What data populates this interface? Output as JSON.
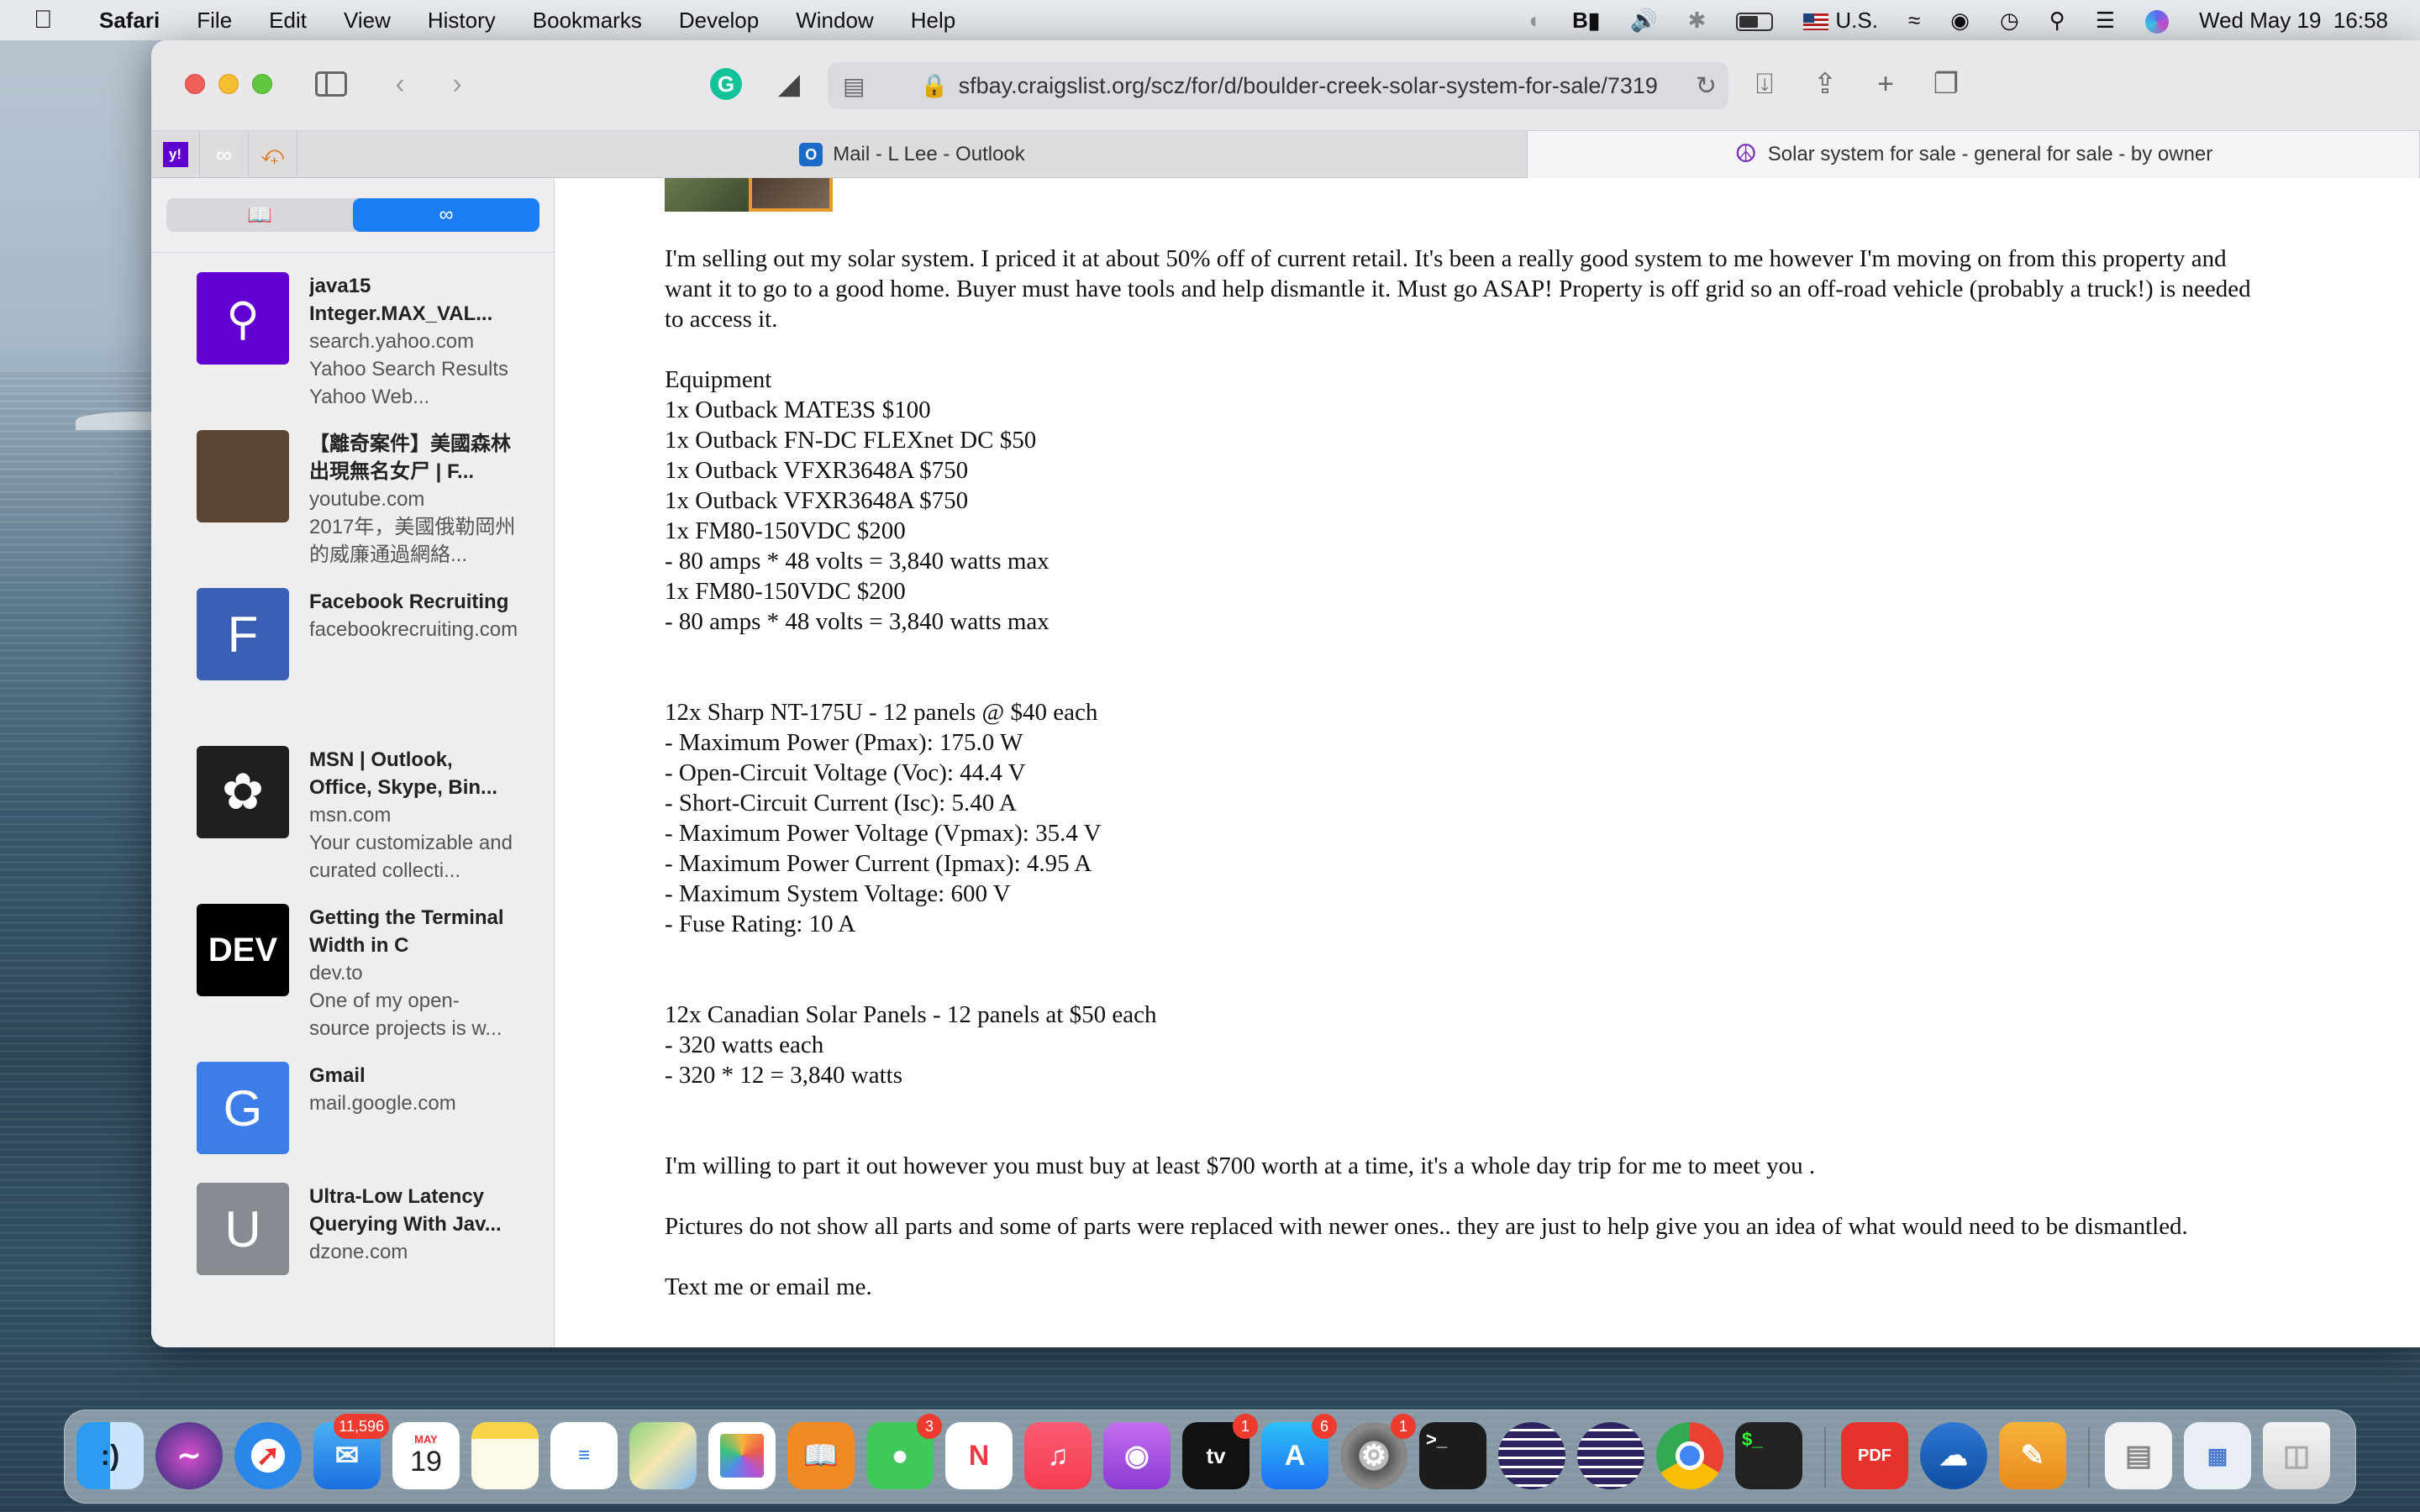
{
  "menubar": {
    "app_name": "Safari",
    "items": [
      "File",
      "Edit",
      "View",
      "History",
      "Bookmarks",
      "Develop",
      "Window",
      "Help"
    ],
    "input_source": "U.S.",
    "datetime": "Wed May 19  16:58"
  },
  "toolbar": {
    "url": "sfbay.craigslist.org/scz/for/d/boulder-creek-solar-system-for-sale/7319"
  },
  "tabs": [
    {
      "label": "Mail - L Lee - Outlook",
      "icon": "outlook-icon"
    },
    {
      "label": "Solar system for sale - general for sale - by owner",
      "icon": "peace-icon"
    }
  ],
  "pinned_tabs": [
    "yahoo-icon",
    "reading-list-icon",
    "custom-site-icon"
  ],
  "sidebar": {
    "reading_list": [
      {
        "title": "java15 Integer.MAX_VAL...",
        "domain": "search.yahoo.com",
        "snippet": "Yahoo Search Results Yahoo Web...",
        "thumb": "yahoo-thumb",
        "color": "#6001d2"
      },
      {
        "title": "【離奇案件】美國森林出現無名女尸 | F...",
        "domain": "youtube.com",
        "snippet": "2017年，美國俄勒岡州的威廉通過網絡...",
        "thumb": "video-thumb",
        "color": "#5a4636"
      },
      {
        "title": "Facebook Recruiting",
        "domain": "facebookrecruiting.com",
        "snippet": "",
        "thumb_letter": "F",
        "color": "#3b5fb5"
      },
      {
        "title": "MSN | Outlook, Office, Skype, Bin...",
        "domain": "msn.com",
        "snippet": "Your customizable and curated collecti...",
        "thumb": "msn-thumb",
        "color": "#1f1f1f"
      },
      {
        "title": "Getting the Terminal Width in C",
        "domain": "dev.to",
        "snippet": "One of my open-source projects is w...",
        "thumb_letter": "DEV",
        "color": "#000000"
      },
      {
        "title": "Gmail",
        "domain": "mail.google.com",
        "snippet": "",
        "thumb_letter": "G",
        "color": "#3d7de8"
      },
      {
        "title": "Ultra-Low Latency Querying With Jav...",
        "domain": "dzone.com",
        "snippet": "",
        "thumb_letter": "U",
        "color": "#878c93"
      }
    ]
  },
  "post": {
    "lines": [
      "I'm selling out my solar system. I priced it at about 50% off of current retail. It's been a really good system to me however I'm moving on from this property and want it to go to a good home. Buyer must have tools and help dismantle it. Must go ASAP! Property is off grid so an off-road vehicle (probably a truck!) is needed to access it.",
      "",
      "Equipment",
      "1x Outback MATE3S $100",
      "1x Outback FN-DC FLEXnet DC $50",
      "1x Outback VFXR3648A $750",
      "1x Outback VFXR3648A $750",
      "1x FM80-150VDC $200",
      "- 80 amps * 48 volts = 3,840 watts max",
      "1x FM80-150VDC $200",
      "- 80 amps * 48 volts = 3,840 watts max",
      "",
      "",
      "12x Sharp NT-175U - 12 panels @ $40 each",
      "- Maximum Power (Pmax): 175.0 W",
      "- Open-Circuit Voltage (Voc): 44.4 V",
      "- Short-Circuit Current (Isc): 5.40 A",
      "- Maximum Power Voltage (Vpmax): 35.4 V",
      "- Maximum Power Current (Ipmax): 4.95 A",
      "- Maximum System Voltage: 600 V",
      "- Fuse Rating: 10 A",
      "",
      "",
      "12x Canadian Solar Panels - 12 panels at $50 each",
      "- 320 watts each",
      "- 320 * 12 = 3,840 watts",
      "",
      "",
      "I'm willing to part it out however you must buy at least $700 worth at a time, it's a whole day trip for me to meet you .",
      "",
      "Pictures do not show all parts and some of parts were replaced with newer ones.. they are just to help give you an idea of what would need to be dismantled.",
      "",
      "Text me or email me."
    ]
  },
  "dock": {
    "mail_badge": "11,596",
    "calendar_month": "MAY",
    "calendar_day": "19",
    "messages_badge": "3",
    "tv_badge": "1",
    "appstore_badge": "6",
    "settings_badge": "1",
    "apps": [
      "finder-icon",
      "siri-icon",
      "safari-icon",
      "mail-icon",
      "calendar-icon",
      "notes-icon",
      "reminders-icon",
      "maps-icon",
      "photos-icon",
      "books-icon",
      "messages-icon",
      "news-icon",
      "music-icon",
      "podcasts-icon",
      "tv-icon",
      "appstore-icon",
      "system-preferences-icon",
      "terminal-icon",
      "eclipse-icon",
      "eclipse-icon-2",
      "chrome-icon",
      "iterm-icon",
      "pdf-expert-icon",
      "openoffice-icon",
      "pages-icon",
      "downloads-stack-icon",
      "screenshot-stack-icon",
      "trash-icon"
    ]
  }
}
